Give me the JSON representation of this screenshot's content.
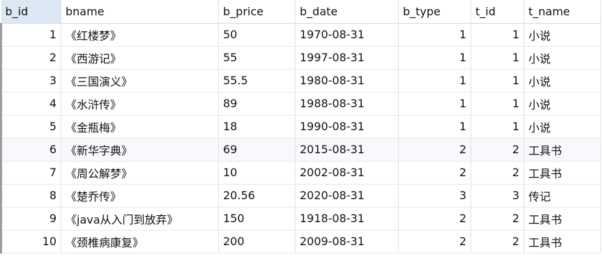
{
  "columns": [
    "b_id",
    "bname",
    "b_price",
    "b_date",
    "b_type",
    "t_id",
    "t_name"
  ],
  "rows": [
    [
      "1",
      "《红楼梦》",
      "50",
      "1970-08-31",
      "1",
      "1",
      "小说"
    ],
    [
      "2",
      "《西游记》",
      "55",
      "1997-08-31",
      "1",
      "1",
      "小说"
    ],
    [
      "3",
      "《三国演义》",
      "55.5",
      "1980-08-31",
      "1",
      "1",
      "小说"
    ],
    [
      "4",
      "《水浒传》",
      "89",
      "1988-08-31",
      "1",
      "1",
      "小说"
    ],
    [
      "5",
      "《金瓶梅》",
      "18",
      "1990-08-31",
      "1",
      "1",
      "小说"
    ],
    [
      "6",
      "《新华字典》",
      "69",
      "2015-08-31",
      "2",
      "2",
      "工具书"
    ],
    [
      "7",
      "《周公解梦》",
      "10",
      "2002-08-31",
      "2",
      "2",
      "工具书"
    ],
    [
      "8",
      "《楚乔传》",
      "20.56",
      "2020-08-31",
      "3",
      "3",
      "传记"
    ],
    [
      "9",
      "《java从入门到放弃》",
      "150",
      "1918-08-31",
      "2",
      "2",
      "工具书"
    ],
    [
      "10",
      "《颈椎病康复》",
      "200",
      "2009-08-31",
      "2",
      "2",
      "工具书"
    ]
  ]
}
